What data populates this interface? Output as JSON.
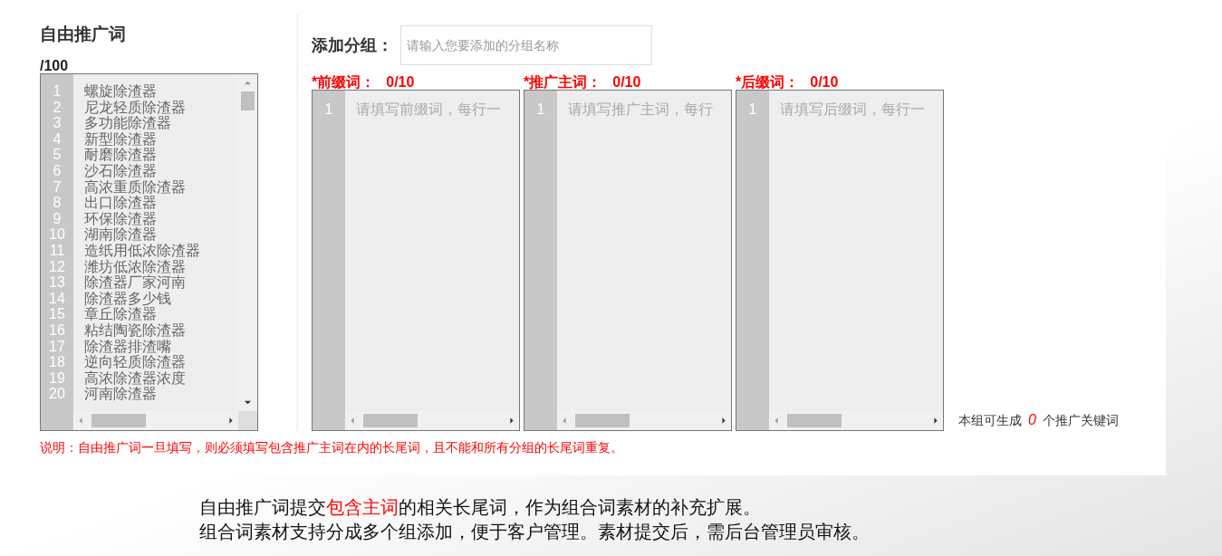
{
  "free_keywords": {
    "title": "自由推广词",
    "count": "/100",
    "lines": [
      {
        "number": "1",
        "text": "螺旋除渣器"
      },
      {
        "number": "2",
        "text": "尼龙轻质除渣器"
      },
      {
        "number": "3",
        "text": "多功能除渣器"
      },
      {
        "number": "4",
        "text": "新型除渣器"
      },
      {
        "number": "5",
        "text": "耐磨除渣器"
      },
      {
        "number": "6",
        "text": "沙石除渣器"
      },
      {
        "number": "7",
        "text": "高浓重质除渣器"
      },
      {
        "number": "8",
        "text": "出口除渣器"
      },
      {
        "number": "9",
        "text": "环保除渣器"
      },
      {
        "number": "10",
        "text": "湖南除渣器"
      },
      {
        "number": "11",
        "text": "造纸用低浓除渣器"
      },
      {
        "number": "12",
        "text": "潍坊低浓除渣器"
      },
      {
        "number": "13",
        "text": "除渣器厂家河南"
      },
      {
        "number": "14",
        "text": "除渣器多少钱"
      },
      {
        "number": "15",
        "text": "章丘除渣器"
      },
      {
        "number": "16",
        "text": "粘结陶瓷除渣器"
      },
      {
        "number": "17",
        "text": "除渣器排渣嘴"
      },
      {
        "number": "18",
        "text": "逆向轻质除渣器"
      },
      {
        "number": "19",
        "text": "高浓除渣器浓度"
      },
      {
        "number": "20",
        "text": "河南除渣器"
      }
    ]
  },
  "add_group": {
    "label": "添加分组：",
    "placeholder": "请输入您要添加的分组名称"
  },
  "groups": [
    {
      "label": "*前缀词：",
      "count": "0/10",
      "line_number": "1",
      "placeholder": "请填写前缀词，每行一"
    },
    {
      "label": "*推广主词：",
      "count": "0/10",
      "line_number": "1",
      "placeholder": "请填写推广主词，每行"
    },
    {
      "label": "*后缀词：",
      "count": "0/10",
      "line_number": "1",
      "placeholder": "请填写后缀词，每行一"
    }
  ],
  "result_note": {
    "prefix": "本组可生成",
    "count": "0",
    "suffix": "个推广关键词"
  },
  "notice": "说明：自由推广词一旦填写，则必须填写包含推广主词在内的长尾词，且不能和所有分组的长尾词重复。",
  "caption": [
    [
      {
        "text": "自由推广词提交",
        "highlight": false
      },
      {
        "text": "包含主词",
        "highlight": true
      },
      {
        "text": "的相关长尾词，作为组合词素材的补充扩展。",
        "highlight": false
      }
    ],
    [
      {
        "text": "组合词素材支持分成多个组添加，便于客户管理。素材提交后，需后台管理员审核。",
        "highlight": false
      }
    ]
  ]
}
